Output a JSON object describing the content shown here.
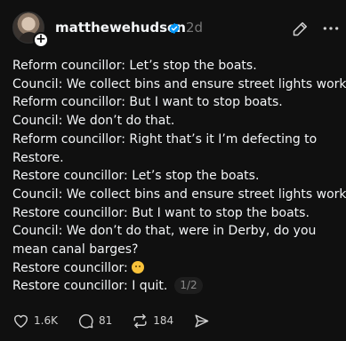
{
  "post": {
    "username": "matthewehudson",
    "time": "2d",
    "follow_badge": "+",
    "lines": [
      "Reform councillor: Let’s stop the boats.",
      "Council: We collect bins and ensure street lights work.",
      "Reform councillor: But I want to stop boats.",
      "Council: We don’t do that.",
      "Reform councillor: Right that’s it I’m defecting to Restore.",
      "Restore councillor: Let’s stop the boats.",
      "Council: We collect bins and ensure street lights work.",
      "Restore councillor: But I want to stop the boats.",
      "Council: We don’t do that, were in Derby, do you mean canal barges?",
      "Restore councillor:",
      "Restore councillor: I quit."
    ],
    "emoji": "🫢",
    "pager": "1/2"
  },
  "actions": {
    "likes": "1.6K",
    "replies": "81",
    "reposts": "184"
  },
  "icons": [
    "verified-icon",
    "edit-icon",
    "more-icon",
    "heart-icon",
    "comment-icon",
    "repost-icon",
    "share-icon"
  ],
  "colors": {
    "background": "#101010",
    "text": "#f3f5f7",
    "muted": "#777777",
    "verified": "#0095f6"
  }
}
